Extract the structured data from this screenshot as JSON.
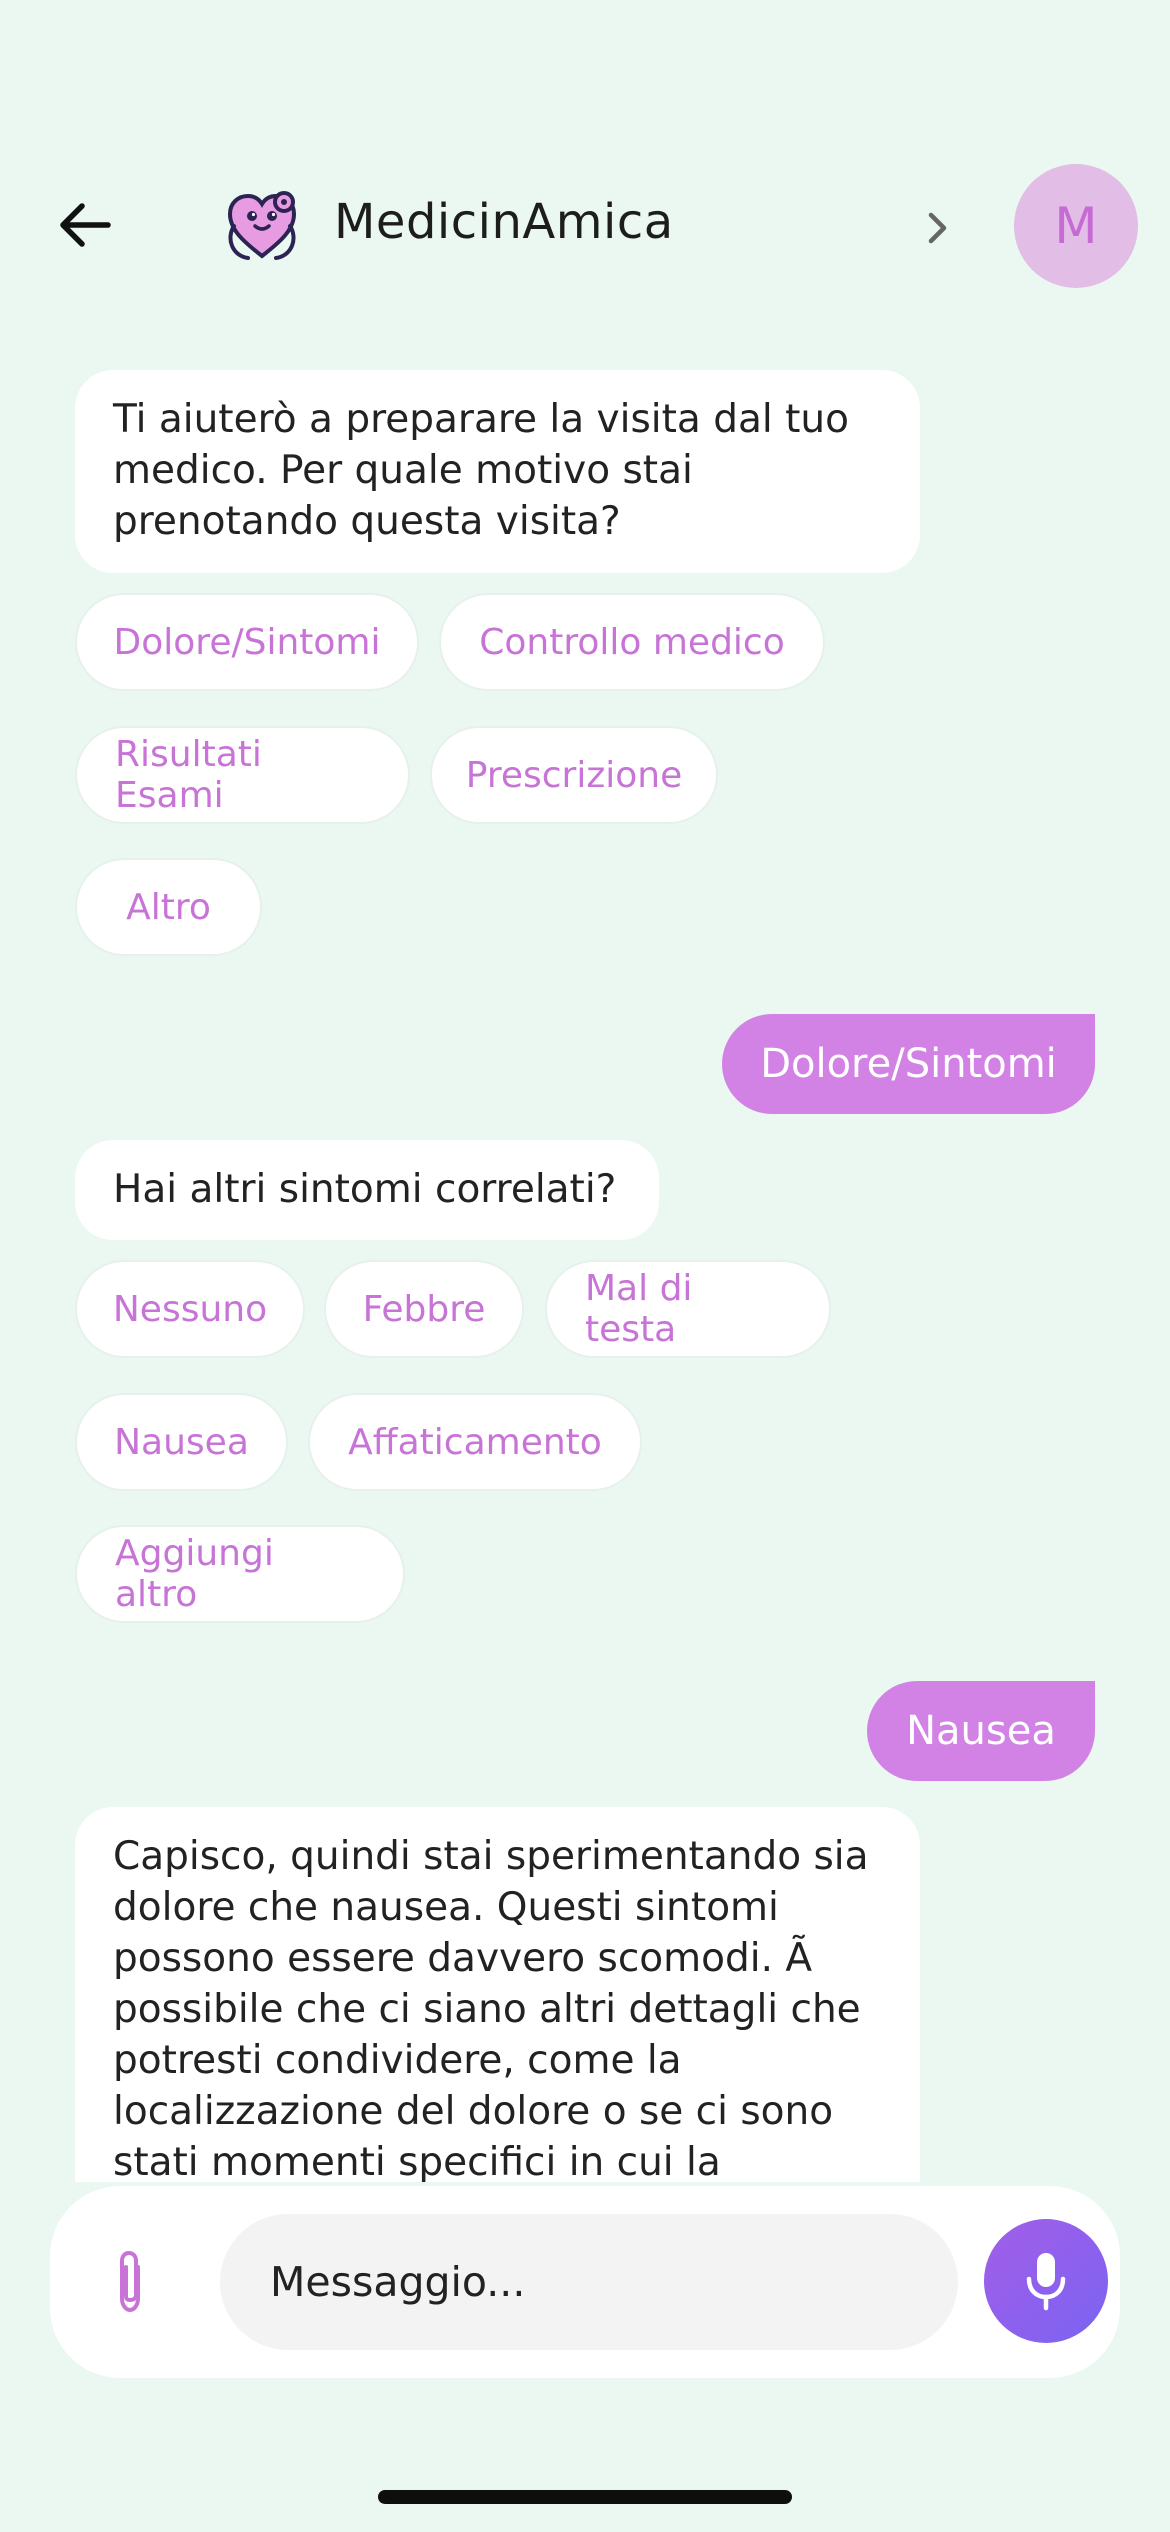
{
  "header": {
    "title": "MedicinAmica",
    "avatar_initial": "M",
    "icons": {
      "back": "arrow-left-icon",
      "logo": "heart-stethoscope-logo",
      "next": "chevron-right-icon"
    }
  },
  "colors": {
    "background": "#eaf8f1",
    "accent": "#d282e4",
    "chip_text": "#c774d6",
    "avatar_bg": "#e2bde6",
    "mic_gradient": [
      "#a35ee8",
      "#7a63f2"
    ]
  },
  "chat": {
    "message1": "Ti aiuterò a preparare la visita dal tuo medico. Per quale motivo stai prenotando questa visita?",
    "options1": [
      "Dolore/Sintomi",
      "Controllo medico",
      "Risultati Esami",
      "Prescrizione",
      "Altro"
    ],
    "reply1": "Dolore/Sintomi",
    "message2": "Hai altri sintomi correlati?",
    "options2": [
      "Nessuno",
      "Febbre",
      "Mal di testa",
      "Nausea",
      "Affaticamento",
      "Aggiungi altro"
    ],
    "reply2": "Nausea",
    "message3": "Capisco, quindi stai sperimentando sia dolore che nausea. Questi sintomi possono essere davvero scomodi. Ã possibile che ci siano altri dettagli che potresti condividere, come la localizzazione del dolore o se ci sono stati momenti specifici in cui la"
  },
  "composer": {
    "placeholder": "Messaggio...",
    "icons": {
      "attach": "paperclip-icon",
      "mic": "microphone-icon"
    }
  }
}
